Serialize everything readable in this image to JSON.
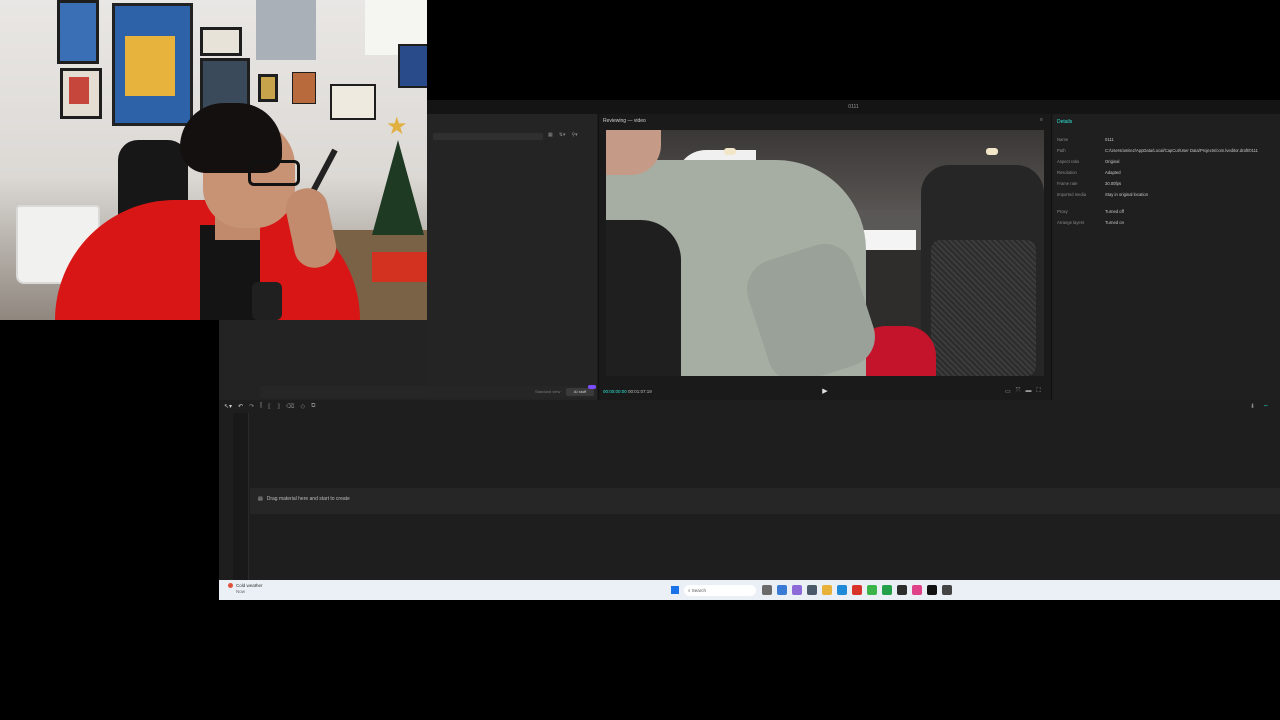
{
  "editor": {
    "window_title": "0111",
    "player": {
      "title": "Reviewing — video",
      "current_time": "00:00:00:00",
      "total_time": "00:01:07:19"
    },
    "media": {
      "footer_label": "Standard view",
      "ai_badge": "AI stuff"
    },
    "details": {
      "tab": "Details",
      "rows": [
        {
          "key": "Name",
          "value": "0111"
        },
        {
          "key": "Path",
          "value": "C:/Users/amitez/AppData/Local/CapCut/User Data/Projects/com.lveditor.draft/0111"
        },
        {
          "key": "Aspect ratio",
          "value": "Original"
        },
        {
          "key": "Resolution",
          "value": "Adapted"
        },
        {
          "key": "Frame rate",
          "value": "30.00fps"
        },
        {
          "key": "Imported media",
          "value": "Stay in original location"
        },
        {
          "key": "Proxy",
          "value": "Turned off"
        },
        {
          "key": "Arrange layers",
          "value": "Turned on"
        }
      ]
    },
    "timeline": {
      "drop_label": "Drag material here and start to create"
    }
  },
  "taskbar": {
    "weather_title": "Cold weather",
    "weather_sub": "Now",
    "search_placeholder": "Search"
  },
  "colors": {
    "accent": "#2ee6d6",
    "panel_bg": "#1f1f1f",
    "taskbar_bg": "#eaf0f6"
  }
}
